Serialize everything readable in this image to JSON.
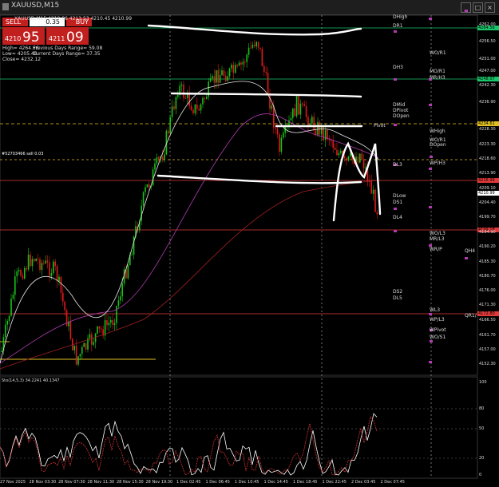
{
  "window": {
    "title": "XAUUSD,M15"
  },
  "trade_panel": {
    "sell_label": "SELL",
    "buy_label": "BUY",
    "lot": "0.35",
    "sell_price_small": "4210",
    "sell_price_big": "95",
    "buy_price_small": "4211",
    "buy_price_big": "09"
  },
  "info": {
    "high": "High= 4264.56",
    "low": "Low= 4205.48",
    "close": "Close= 4232.12",
    "prev_range": "Previous Days Range= 59.08",
    "curr_range": "Current Days Range= 37.35"
  },
  "ohlc_text": "XAUUSD,M15 4212.86 4213.53 4210.45 4210.99",
  "h_label": "#52703466 sell 0.03",
  "pivot_text": "Pivot",
  "chart_labels": [
    {
      "text": "DHigh",
      "y": 4264.2
    },
    {
      "text": "DR1",
      "y": 4261.5
    },
    {
      "text": "WO/R1",
      "y": 4252.8
    },
    {
      "text": "DH3",
      "y": 4248.0
    },
    {
      "text": "MO/R1",
      "y": 4246.8
    },
    {
      "text": "MR/H3",
      "y": 4244.8
    },
    {
      "text": "DMid",
      "y": 4236.0
    },
    {
      "text": "DPivot",
      "y": 4234.0
    },
    {
      "text": "DOpen",
      "y": 4232.2
    },
    {
      "text": "WHigh",
      "y": 4227.4
    },
    {
      "text": "WO/R1",
      "y": 4224.5
    },
    {
      "text": "DOpen",
      "y": 4223.0
    },
    {
      "text": "DL3",
      "y": 4216.5
    },
    {
      "text": "WP/H3",
      "y": 4217.0
    },
    {
      "text": "DLow",
      "y": 4206.6
    },
    {
      "text": "DS1",
      "y": 4204.4
    },
    {
      "text": "DL4",
      "y": 4199.6
    },
    {
      "text": "WO/L3",
      "y": 4194.3
    },
    {
      "text": "MR/L3",
      "y": 4192.5
    },
    {
      "text": "WR/P",
      "y": 4189.2
    },
    {
      "text": "QH4",
      "y": 4188.8
    },
    {
      "text": "DS2",
      "y": 4175.5
    },
    {
      "text": "DL5",
      "y": 4173.4
    },
    {
      "text": "WL3",
      "y": 4169.5
    },
    {
      "text": "QR1/",
      "y": 4167.7
    },
    {
      "text": "WP/L3",
      "y": 4166.4
    },
    {
      "text": "WPivot",
      "y": 4163.2
    },
    {
      "text": "WO/S1",
      "y": 4160.8
    }
  ],
  "price_tags": [
    {
      "value": "4264.56",
      "color": "#19c76a"
    },
    {
      "value": "4248.07",
      "color": "#19c76a"
    },
    {
      "value": "4234.61",
      "color": "#e0c020"
    },
    {
      "value": "4216.99",
      "color": "#e23a3a"
    },
    {
      "value": "4210.99",
      "color": "#ffffff"
    },
    {
      "value": "4199.18",
      "color": "#e23a3a"
    },
    {
      "value": "4172.80",
      "color": "#e23a3a"
    }
  ],
  "y_ticks": [
    "4262.00",
    "4256.50",
    "4251.00",
    "4247.00",
    "4242.30",
    "4236.90",
    "4228.30",
    "4223.30",
    "4218.60",
    "4213.90",
    "4209.10",
    "4204.40",
    "4199.70",
    "4194.90",
    "4190.20",
    "4185.30",
    "4180.70",
    "4176.00",
    "4171.30",
    "4166.50",
    "4161.70",
    "4157.00",
    "4152.30"
  ],
  "x_ticks": [
    "27 Nov 2025",
    "28 Nov 03:30",
    "28 Nov 07:30",
    "28 Nov 11:30",
    "28 Nov 15:30",
    "28 Nov 19:30",
    "1 Dec 02:45",
    "1 Dec 06:45",
    "1 Dec 10:45",
    "1 Dec 14:45",
    "1 Dec 18:45",
    "1 Dec 22:45",
    "2 Dec 03:45",
    "2 Dec 07:45"
  ],
  "oscillator": {
    "label": "Sto(14,5,3) 34.2241 40.1347",
    "ticks": [
      "100",
      "80",
      "50",
      "20",
      "0"
    ]
  },
  "colors": {
    "bull": "#19c219",
    "bear": "#e01b1b",
    "ma_white": "#e8e8e8",
    "ma_magenta": "#b03cb0",
    "ma_darkred": "#a02020",
    "green_line": "#19c76a",
    "red_line": "#e23a3a",
    "yellow_line": "#e0c020"
  }
}
